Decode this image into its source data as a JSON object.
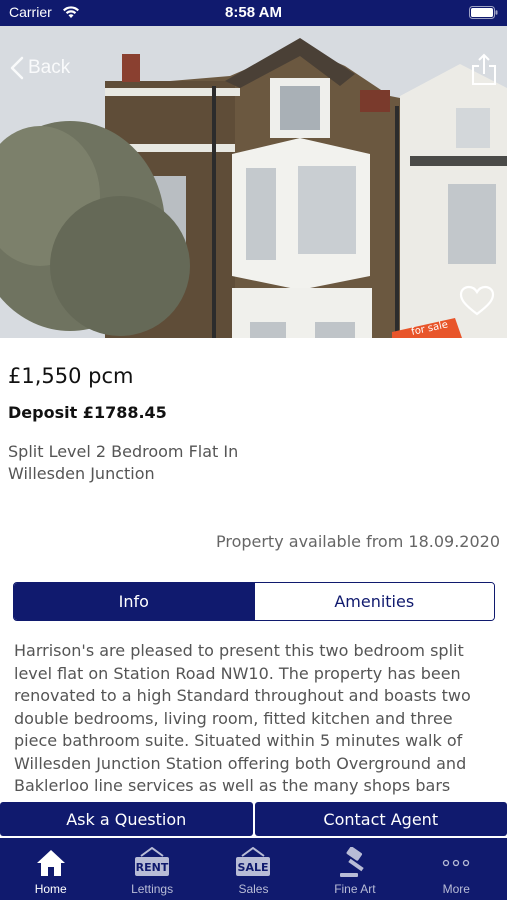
{
  "status_bar": {
    "carrier": "Carrier",
    "time": "8:58 AM"
  },
  "nav": {
    "back_label": "Back"
  },
  "property": {
    "price": "£1,550 pcm",
    "deposit": "Deposit £1788.45",
    "title": "Split Level 2 Bedroom Flat In Willesden Junction",
    "available": "Property available from 18.09.2020",
    "photo_sign": "for sale"
  },
  "tabs": {
    "info": "Info",
    "amenities": "Amenities",
    "selected": "Info"
  },
  "description": "Harrison's are pleased to present this two bedroom split level flat on Station Road NW10. The property has been renovated to a high Standard throughout and boasts two double bedrooms, living room, fitted kitchen and three piece bathroom suite. Situated within 5 minutes walk of Willesden Junction Station offering both Overground and Baklerloo line services as well as the many shops bars",
  "actions": {
    "ask": "Ask a Question",
    "contact": "Contact Agent"
  },
  "tabbar": {
    "items": [
      {
        "label": "Home",
        "icon": "house-icon"
      },
      {
        "label": "Lettings",
        "icon": "rent-sign-icon",
        "icon_text": "RENT"
      },
      {
        "label": "Sales",
        "icon": "sale-sign-icon",
        "icon_text": "SALE"
      },
      {
        "label": "Fine Art",
        "icon": "gavel-icon"
      },
      {
        "label": "More",
        "icon": "more-dots-icon"
      }
    ],
    "active": "Home"
  },
  "colors": {
    "brand": "#101a6e",
    "text_muted": "#555555",
    "tab_inactive": "#b8bcd6"
  }
}
